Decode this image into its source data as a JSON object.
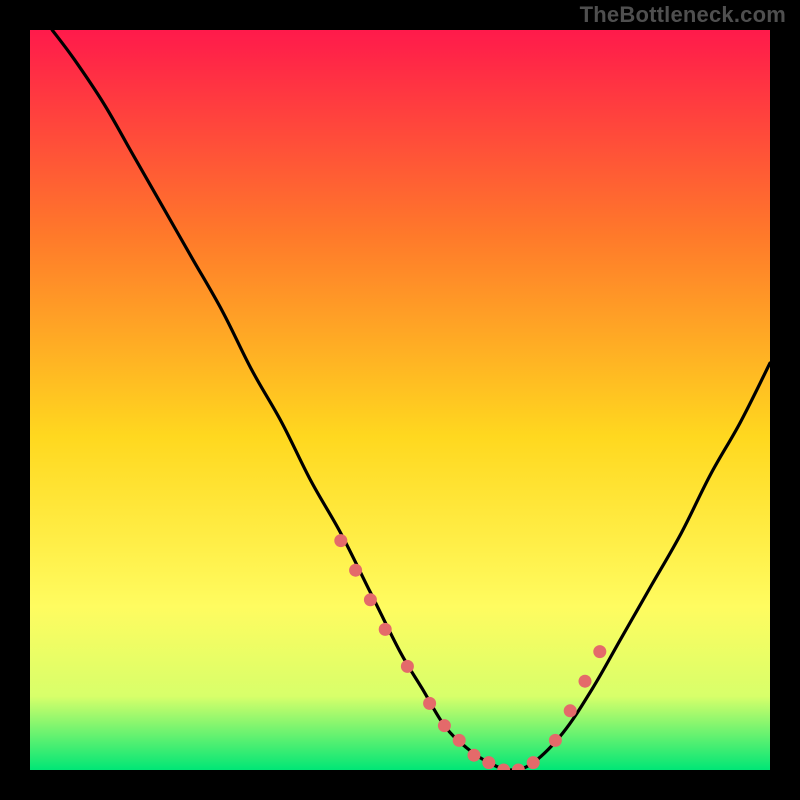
{
  "watermark": "TheBottleneck.com",
  "colors": {
    "bg_black": "#000000",
    "grad_top": "#ff1a4b",
    "grad_mid_upper": "#ff7a2a",
    "grad_mid": "#ffd81f",
    "grad_mid_lower": "#fffc60",
    "grad_lower": "#d8ff6a",
    "grad_bottom": "#00e676",
    "curve": "#000000",
    "marker": "#e46a6a",
    "watermark": "#4f4f4f"
  },
  "chart_data": {
    "type": "line",
    "title": "",
    "xlabel": "",
    "ylabel": "",
    "xlim": [
      0,
      100
    ],
    "ylim": [
      0,
      100
    ],
    "grid": false,
    "legend_position": "none",
    "series": [
      {
        "name": "bottleneck-curve",
        "x": [
          3,
          6,
          10,
          14,
          18,
          22,
          26,
          30,
          34,
          38,
          42,
          46,
          50,
          53,
          56,
          59,
          62,
          65,
          68,
          72,
          76,
          80,
          84,
          88,
          92,
          96,
          100
        ],
        "y": [
          100,
          96,
          90,
          83,
          76,
          69,
          62,
          54,
          47,
          39,
          32,
          24,
          16,
          11,
          6,
          3,
          1,
          0,
          1,
          5,
          11,
          18,
          25,
          32,
          40,
          47,
          55
        ]
      }
    ],
    "markers": {
      "name": "highlight-points",
      "x": [
        42,
        44,
        46,
        48,
        51,
        54,
        56,
        58,
        60,
        62,
        64,
        66,
        68,
        71,
        73,
        75,
        77
      ],
      "y": [
        31,
        27,
        23,
        19,
        14,
        9,
        6,
        4,
        2,
        1,
        0,
        0,
        1,
        4,
        8,
        12,
        16
      ]
    }
  }
}
